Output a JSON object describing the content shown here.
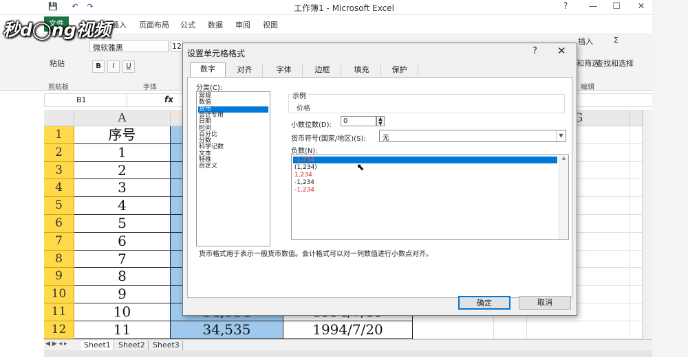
{
  "window": {
    "title": "工作簿1 - Microsoft Excel",
    "help": "?",
    "minimize": "—",
    "maximize": "☐",
    "close": "✕"
  },
  "watermark": {
    "text": "秒d◯ng视频"
  },
  "quick_access": {
    "save": "💾",
    "undo": "↶",
    "redo": "↷"
  },
  "ribbon": {
    "file_tab": "文件",
    "tabs": [
      "插入",
      "页面布局",
      "公式",
      "数据",
      "审阅",
      "视图"
    ],
    "font_name": "微软雅黑",
    "font_size": "12",
    "paste": "粘贴",
    "bold": "B",
    "italic": "I",
    "underline": "U",
    "clipboard_group": "剪贴板",
    "font_group": "字体",
    "editing_group": "编辑",
    "insert_btn": "插入",
    "sigma": "Σ",
    "filter_btn": "和筛选",
    "find_btn": "查找和选择"
  },
  "formula_bar": {
    "name_box": "B1",
    "fx": "fx"
  },
  "grid": {
    "columns": [
      "A",
      "G"
    ],
    "rows": [
      {
        "num": "1",
        "a": "序号",
        "b": "",
        "c": ""
      },
      {
        "num": "2",
        "a": "1",
        "b": "",
        "c": ""
      },
      {
        "num": "3",
        "a": "2",
        "b": "",
        "c": ""
      },
      {
        "num": "4",
        "a": "3",
        "b": "",
        "c": ""
      },
      {
        "num": "5",
        "a": "4",
        "b": "",
        "c": ""
      },
      {
        "num": "6",
        "a": "5",
        "b": "",
        "c": ""
      },
      {
        "num": "7",
        "a": "6",
        "b": "",
        "c": ""
      },
      {
        "num": "8",
        "a": "7",
        "b": "",
        "c": ""
      },
      {
        "num": "9",
        "a": "8",
        "b": "",
        "c": ""
      },
      {
        "num": "10",
        "a": "9",
        "b": "",
        "c": ""
      },
      {
        "num": "11",
        "a": "10",
        "b": "34,534",
        "c": "1994/7/19"
      },
      {
        "num": "12",
        "a": "11",
        "b": "34,535",
        "c": "1994/7/20"
      }
    ]
  },
  "sheets": [
    "Sheet1",
    "Sheet2",
    "Sheet3"
  ],
  "dialog": {
    "title": "设置单元格格式",
    "help": "?",
    "close": "✕",
    "tabs": [
      "数字",
      "对齐",
      "字体",
      "边框",
      "填充",
      "保护"
    ],
    "category_label": "分类(C):",
    "categories": [
      "常规",
      "数值",
      "货币",
      "会计专用",
      "日期",
      "时间",
      "百分比",
      "分数",
      "科学记数",
      "文本",
      "特殊",
      "自定义"
    ],
    "selected_category": "货币",
    "sample_label": "示例",
    "sample_value": "价格",
    "decimal_label": "小数位数(D):",
    "decimal_value": "0",
    "symbol_label": "货币符号(国家/地区)(S):",
    "symbol_value": "无",
    "negative_label": "负数(N):",
    "negatives": [
      "-1,234",
      "(1,234)",
      "1,234",
      "-1,234",
      "-1,234"
    ],
    "description": "货币格式用于表示一般货币数值。会计格式可以对一列数值进行小数点对齐。",
    "ok": "确定",
    "cancel": "取消"
  }
}
